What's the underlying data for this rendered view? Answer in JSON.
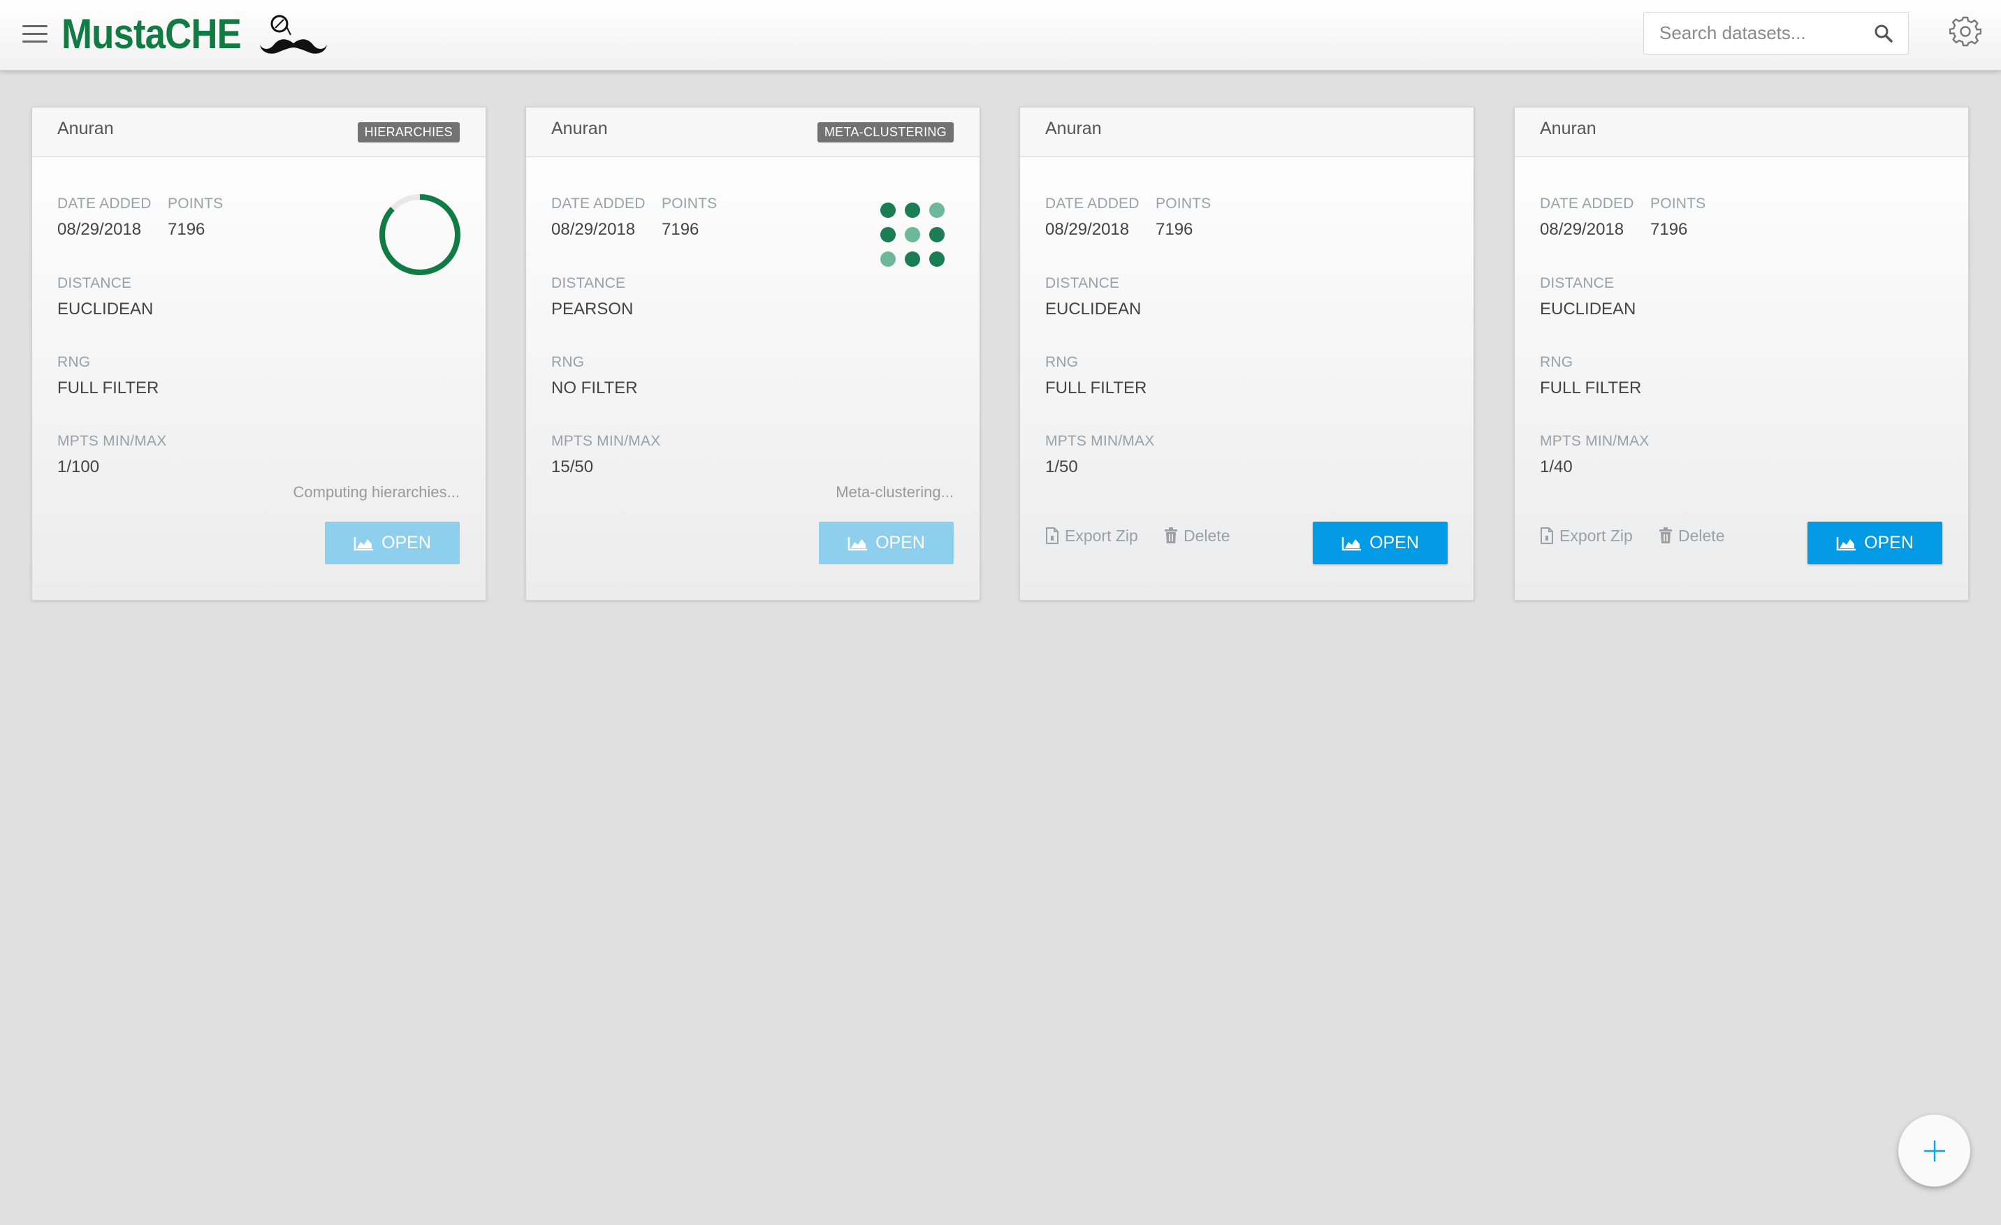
{
  "app": {
    "title": "MustaCHE"
  },
  "search": {
    "placeholder": "Search datasets..."
  },
  "labels": {
    "date_added": "DATE ADDED",
    "points": "POINTS",
    "distance": "DISTANCE",
    "rng": "RNG",
    "mpts": "MPTS MIN/MAX",
    "open": "OPEN",
    "export": "Export Zip",
    "delete": "Delete"
  },
  "cards": [
    {
      "title": "Anuran",
      "badge": "HIERARCHIES",
      "date_added": "08/29/2018",
      "points": "7196",
      "distance": "EUCLIDEAN",
      "rng": "FULL FILTER",
      "mpts": "1/100",
      "status": "Computing hierarchies...",
      "progress": 0.87
    },
    {
      "title": "Anuran",
      "badge": "META-CLUSTERING",
      "date_added": "08/29/2018",
      "points": "7196",
      "distance": "PEARSON",
      "rng": "NO FILTER",
      "mpts": "15/50",
      "status": "Meta-clustering..."
    },
    {
      "title": "Anuran",
      "date_added": "08/29/2018",
      "points": "7196",
      "distance": "EUCLIDEAN",
      "rng": "FULL FILTER",
      "mpts": "1/50"
    },
    {
      "title": "Anuran",
      "date_added": "08/29/2018",
      "points": "7196",
      "distance": "EUCLIDEAN",
      "rng": "FULL FILTER",
      "mpts": "1/40"
    }
  ],
  "icons": {
    "menu": "hamburger-menu-icon",
    "search": "search-icon",
    "settings": "gear-icon",
    "open": "area-chart-icon",
    "export": "zip-file-icon",
    "delete": "trash-icon",
    "add": "plus-icon"
  },
  "colors": {
    "brand": "#107c44",
    "primary_button": "#039be5",
    "disabled_button": "#8fcfee",
    "badge": "#727272",
    "spinner": "#107c44"
  }
}
